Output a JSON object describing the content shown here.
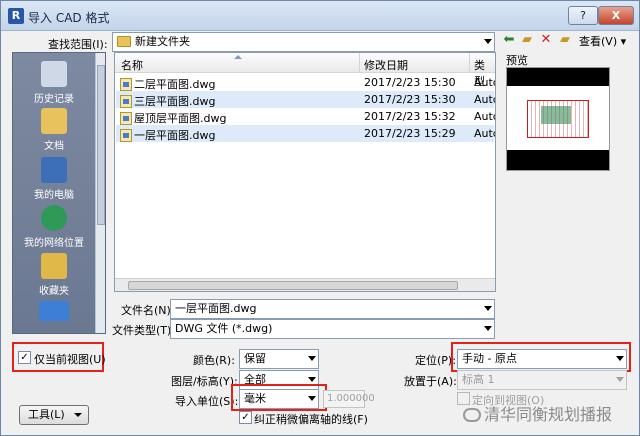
{
  "window": {
    "title": "导入 CAD 格式",
    "help_label": "?",
    "close_label": "X"
  },
  "lookin": {
    "label": "查找范围(I):",
    "value": "新建文件夹",
    "view_label": "查看(V)"
  },
  "places": [
    {
      "label": "历史记录",
      "icon": "history-icon",
      "color": "#cfd8e6"
    },
    {
      "label": "文档",
      "icon": "documents-folder-icon",
      "color": "#e8c25c"
    },
    {
      "label": "我的电脑",
      "icon": "computer-icon",
      "color": "#3d6fb8"
    },
    {
      "label": "我的网络位置",
      "icon": "network-globe-icon",
      "color": "#2e9a58"
    },
    {
      "label": "收藏夹",
      "icon": "favorites-folder-icon",
      "color": "#e0b84a"
    },
    {
      "label": "",
      "icon": "desktop-icon",
      "color": "#3b7fd6"
    }
  ],
  "filelist": {
    "columns": [
      "名称",
      "修改日期",
      "类型"
    ],
    "rows": [
      {
        "name": "二层平面图.dwg",
        "date": "2017/2/23 15:30",
        "type": "Autc",
        "selected": false
      },
      {
        "name": "三层平面图.dwg",
        "date": "2017/2/23 15:30",
        "type": "Autc",
        "selected": true
      },
      {
        "name": "屋顶层平面图.dwg",
        "date": "2017/2/23 15:32",
        "type": "Autc",
        "selected": false
      },
      {
        "name": "一层平面图.dwg",
        "date": "2017/2/23 15:29",
        "type": "Autc",
        "selected": true
      }
    ]
  },
  "preview": {
    "label": "预览"
  },
  "filename": {
    "label": "文件名(N):",
    "value": "一层平面图.dwg"
  },
  "filetype": {
    "label": "文件类型(T):",
    "value": "DWG 文件 (*.dwg)"
  },
  "options": {
    "current_view": {
      "label": "仅当前视图(U)",
      "checked": true
    },
    "color": {
      "label": "颜色(R):",
      "value": "保留"
    },
    "layers": {
      "label": "图层/标高(Y):",
      "value": "全部"
    },
    "units": {
      "label": "导入单位(S):",
      "value": "毫米",
      "factor": "1.000000"
    },
    "correct_lines": {
      "label": "纠正稍微偏离轴的线(F)",
      "checked": true
    },
    "positioning": {
      "label": "定位(P):",
      "value": "手动 - 原点"
    },
    "place_at": {
      "label": "放置于(A):",
      "value": "标高 1"
    },
    "orient_view": {
      "label": "定向到视图(O)",
      "checked": false
    },
    "tools_label": "工具(L)"
  },
  "watermark": "清华同衡规划播报",
  "colors": {
    "highlight": "#e2231a",
    "selection": "#dceaf9"
  }
}
